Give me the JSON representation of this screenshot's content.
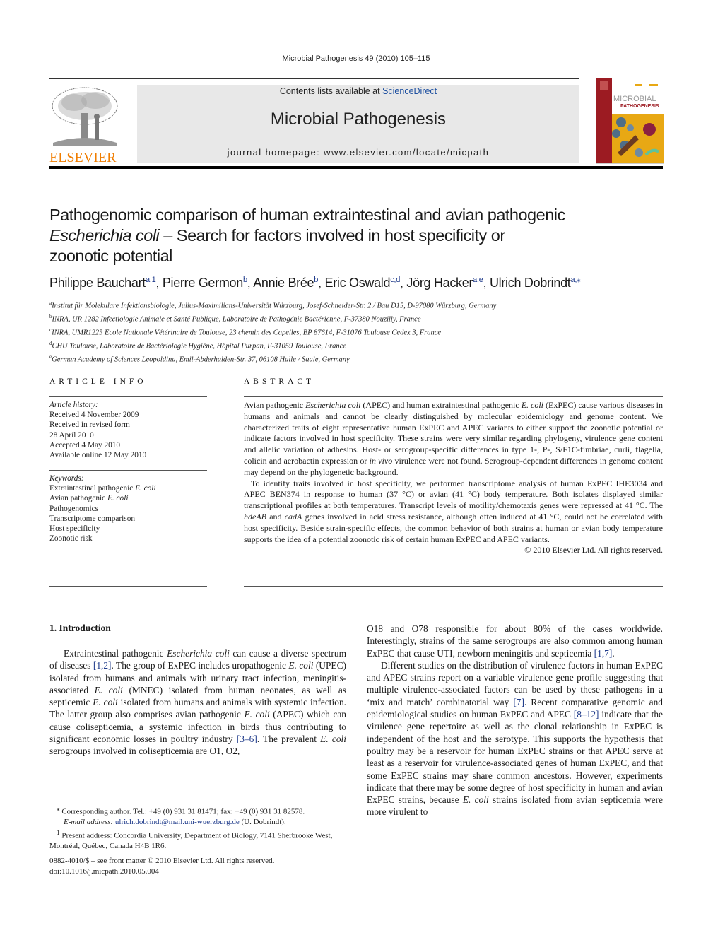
{
  "running_header": "Microbial Pathogenesis 49 (2010) 105–115",
  "publisher": {
    "wordmark": "ELSEVIER"
  },
  "journal_banner": {
    "contents_prefix": "Contents lists available at ",
    "contents_link": "ScienceDirect",
    "journal_title": "Microbial Pathogenesis",
    "homepage": "journal homepage: www.elsevier.com/locate/micpath"
  },
  "cover": {
    "line1": "MICROBIAL",
    "line2": "PATHOGENESIS"
  },
  "article": {
    "title_line1": "Pathogenomic comparison of human extraintestinal and avian pathogenic",
    "title_italic": "Escherichia coli",
    "title_line2_rest": " – Search for factors involved in host specificity or",
    "title_line3": "zoonotic potential",
    "authors": [
      {
        "name": "Philippe Bauchart",
        "sup": "a,1"
      },
      {
        "name": "Pierre Germon",
        "sup": "b"
      },
      {
        "name": "Annie Brée",
        "sup": "b"
      },
      {
        "name": "Eric Oswald",
        "sup": "c,d"
      },
      {
        "name": "Jörg Hacker",
        "sup": "a,e"
      },
      {
        "name": "Ulrich Dobrindt",
        "sup": "a,⁎"
      }
    ],
    "affiliations": [
      {
        "key": "a",
        "text": "Institut für Molekulare Infektionsbiologie, Julius-Maximilians-Universität Würzburg, Josef-Schneider-Str. 2 / Bau D15, D-97080 Würzburg, Germany"
      },
      {
        "key": "b",
        "text": "INRA, UR 1282 Infectiologie Animale et Santé Publique, Laboratoire de Pathogénie Bactérienne, F-37380 Nouzilly, France"
      },
      {
        "key": "c",
        "text": "INRA, UMR1225 Ecole Nationale Vétérinaire de Toulouse, 23 chemin des Capelles, BP 87614, F-31076 Toulouse Cedex 3, France"
      },
      {
        "key": "d",
        "text": "CHU Toulouse, Laboratoire de Bactériologie Hygiène, Hôpital Purpan, F-31059 Toulouse, France"
      },
      {
        "key": "e",
        "text": "German Academy of Sciences Leopoldina, Emil-Abderhalden-Str. 37, 06108 Halle / Saale, Germany"
      }
    ]
  },
  "article_info": {
    "heading": "ARTICLE INFO",
    "history_label": "Article history:",
    "history": [
      "Received 4 November 2009",
      "Received in revised form",
      "28 April 2010",
      "Accepted 4 May 2010",
      "Available online 12 May 2010"
    ],
    "keywords_label": "Keywords:",
    "keywords": [
      {
        "text": "Extraintestinal pathogenic ",
        "italic": "E. coli"
      },
      {
        "text": "Avian pathogenic ",
        "italic": "E. coli"
      },
      {
        "text": "Pathogenomics",
        "italic": ""
      },
      {
        "text": "Transcriptome comparison",
        "italic": ""
      },
      {
        "text": "Host specificity",
        "italic": ""
      },
      {
        "text": "Zoonotic risk",
        "italic": ""
      }
    ]
  },
  "abstract": {
    "heading": "ABSTRACT",
    "p1": [
      {
        "t": "Avian pathogenic "
      },
      {
        "i": "Escherichia coli"
      },
      {
        "t": " (APEC) and human extraintestinal pathogenic "
      },
      {
        "i": "E. coli"
      },
      {
        "t": " (ExPEC) cause various diseases in humans and animals and cannot be clearly distinguished by molecular epidemiology and genome content. We characterized traits of eight representative human ExPEC and APEC variants to either support the zoonotic potential or indicate factors involved in host specificity. These strains were very similar regarding phylogeny, virulence gene content and allelic variation of adhesins. Host- or serogroup-specific differences in type 1-, P-, S/F1C-fimbriae, curli, flagella, colicin and aerobactin expression or "
      },
      {
        "i": "in vivo"
      },
      {
        "t": " virulence were not found. Serogroup-dependent differences in genome content may depend on the phylogenetic background."
      }
    ],
    "p2": [
      {
        "t": "To identify traits involved in host specificity, we performed transcriptome analysis of human ExPEC IHE3034 and APEC BEN374 in response to human (37 °C) or avian (41 °C) body temperature. Both isolates displayed similar transcriptional profiles at both temperatures. Transcript levels of motility/chemotaxis genes were repressed at 41 °C. The "
      },
      {
        "i": "hdeAB"
      },
      {
        "t": " and "
      },
      {
        "i": "cadA"
      },
      {
        "t": " genes involved in acid stress resistance, although often induced at 41 °C, could not be correlated with host specificity. Beside strain-specific effects, the common behavior of both strains at human or avian body temperature supports the idea of a potential zoonotic risk of certain human ExPEC and APEC variants."
      }
    ],
    "copyright": "© 2010 Elsevier Ltd. All rights reserved."
  },
  "intro": {
    "heading": "1.  Introduction",
    "left_p1": [
      {
        "t": "Extraintestinal pathogenic "
      },
      {
        "i": "Escherichia coli"
      },
      {
        "t": " can cause a diverse spectrum of diseases "
      },
      {
        "r": "[1,2]"
      },
      {
        "t": ". The group of ExPEC includes uropathogenic "
      },
      {
        "i": "E. coli"
      },
      {
        "t": " (UPEC) isolated from humans and animals with urinary tract infection, meningitis-associated "
      },
      {
        "i": "E. coli"
      },
      {
        "t": " (MNEC) isolated from human neonates, as well as septicemic "
      },
      {
        "i": "E. coli"
      },
      {
        "t": " isolated from humans and animals with systemic infection. The latter group also comprises avian pathogenic "
      },
      {
        "i": "E. coli"
      },
      {
        "t": " (APEC) which can cause colisepticemia, a systemic infection in birds thus contributing to significant economic losses in poultry industry "
      },
      {
        "r": "[3–6]"
      },
      {
        "t": ". The prevalent "
      },
      {
        "i": "E. coli"
      },
      {
        "t": " serogroups involved in colisepticemia are O1, O2,"
      }
    ],
    "right_p1": [
      {
        "t": "O18 and O78 responsible for about 80% of the cases worldwide. Interestingly, strains of the same serogroups are also common among human ExPEC that cause UTI, newborn meningitis and septicemia "
      },
      {
        "r": "[1,7]"
      },
      {
        "t": "."
      }
    ],
    "right_p2": [
      {
        "t": "Different studies on the distribution of virulence factors in human ExPEC and APEC strains report on a variable virulence gene profile suggesting that multiple virulence-associated factors can be used by these pathogens in a ‘mix and match’ combinatorial way "
      },
      {
        "r": "[7]"
      },
      {
        "t": ". Recent comparative genomic and epidemiological studies on human ExPEC and APEC "
      },
      {
        "r": "[8–12]"
      },
      {
        "t": " indicate that the virulence gene repertoire as well as the clonal relationship in ExPEC is independent of the host and the serotype. This supports the hypothesis that poultry may be a reservoir for human ExPEC strains or that APEC serve at least as a reservoir for virulence-associated genes of human ExPEC, and that some ExPEC strains may share common ancestors. However, experiments indicate that there may be some degree of host specificity in human and avian ExPEC strains, because "
      },
      {
        "i": "E. coli"
      },
      {
        "t": " strains isolated from avian septicemia were more virulent to"
      }
    ]
  },
  "footnotes": {
    "corresponding_mark": "⁎",
    "corresponding": "Corresponding author. Tel.: +49 (0) 931 31 81471; fax: +49 (0) 931 31 82578.",
    "email_label": "E-mail address: ",
    "email": "ulrich.dobrindt@mail.uni-wuerzburg.de",
    "email_suffix": " (U. Dobrindt).",
    "present_mark": "1",
    "present": "Present address: Concordia University, Department of Biology, 7141 Sherbrooke West, Montréal, Québec, Canada H4B 1R6."
  },
  "bottom": {
    "issn": "0882-4010/$ – see front matter © 2010 Elsevier Ltd. All rights reserved.",
    "doi": "doi:10.1016/j.micpath.2010.05.004"
  }
}
